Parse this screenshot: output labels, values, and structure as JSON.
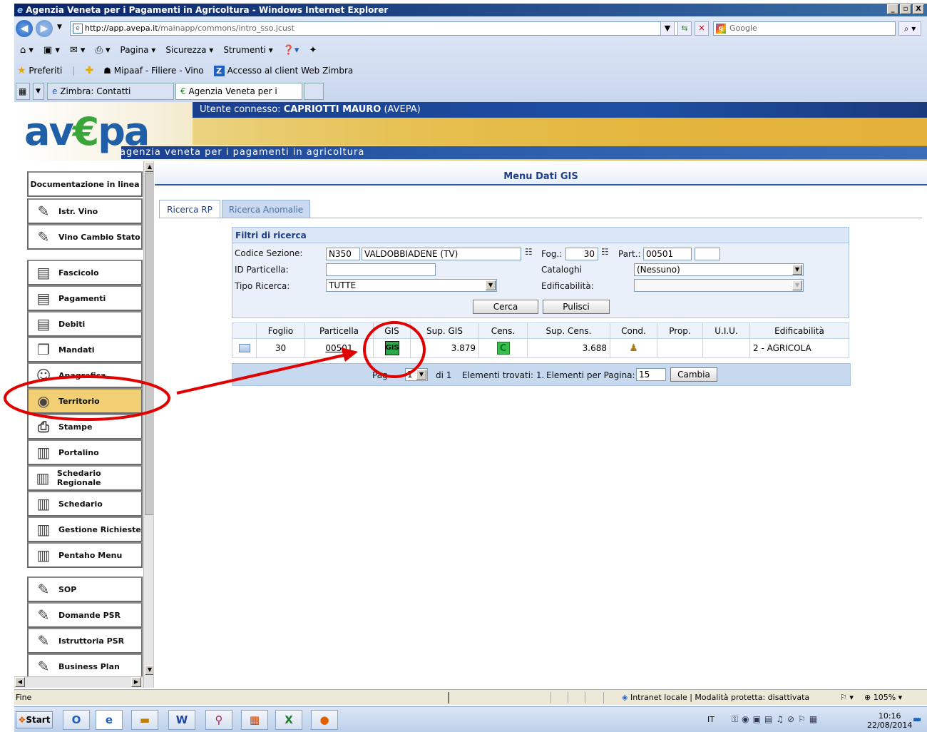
{
  "window": {
    "title": "Agenzia Veneta per i Pagamenti in Agricoltura - Windows Internet Explorer",
    "min": "_",
    "max": "▫",
    "close": "X"
  },
  "browser": {
    "url_host": "http://app.avepa.it",
    "url_path": "/mainapp/commons/intro_sso.jcust",
    "search_placeholder": "Google",
    "commands": [
      "Pagina ▾",
      "Sicurezza ▾",
      "Strumenti ▾"
    ],
    "favorites_label": "Preferiti",
    "favorites": [
      "Mipaaf - Filiere - Vino",
      "Accesso al client Web Zimbra"
    ],
    "tabs": [
      "Zimbra: Contatti",
      "Agenzia Veneta per i Pag..."
    ]
  },
  "header": {
    "user_prefix": "Utente connesso:",
    "user_name": "CAPRIOTTI MAURO",
    "user_org": "(AVEPA)",
    "logo_a": "av",
    "logo_e": "€",
    "logo_b": "pa",
    "tagline": "agenzia veneta per i pagamenti in agricoltura"
  },
  "sidebar": {
    "items": [
      "Documentazione in linea",
      "Istr. Vino",
      "Vino Cambio Stato",
      "Fascicolo",
      "Pagamenti",
      "Debiti",
      "Mandati",
      "Anagrafica",
      "Territorio",
      "Stampe",
      "Portalino",
      "Schedario Regionale",
      "Schedario",
      "Gestione Richieste",
      "Pentaho Menu",
      "SOP",
      "Domande PSR",
      "Istruttoria PSR",
      "Business Plan"
    ],
    "active": "Territorio"
  },
  "main": {
    "title": "Menu Dati GIS",
    "tabs": [
      "Ricerca RP",
      "Ricerca Anomalie"
    ],
    "filters": {
      "heading": "Filtri di ricerca",
      "codice_label": "Codice Sezione:",
      "codice_code": "N350",
      "codice_name": "VALDOBBIADENE (TV)",
      "fog_label": "Fog.:",
      "fog_value": "30",
      "part_label": "Part.:",
      "part_value": "00501",
      "part_extra": "",
      "id_label": "ID Particella:",
      "id_value": "",
      "cataloghi_label": "Cataloghi",
      "cataloghi_value": "(Nessuno)",
      "tipo_label": "Tipo Ricerca:",
      "tipo_value": "TUTTE",
      "edif_label": "Edificabilità:",
      "edif_value": "",
      "search_btn": "Cerca",
      "clear_btn": "Pulisci"
    },
    "results": {
      "columns": [
        "",
        "Foglio",
        "Particella",
        "GIS",
        "Sup. GIS",
        "Cens.",
        "Sup. Cens.",
        "Cond.",
        "Prop.",
        "U.I.U.",
        "Edificabilità"
      ],
      "row": {
        "foglio": "30",
        "particella": "00501",
        "gis": "GIS",
        "sup_gis": "3.879",
        "cens": "C",
        "sup_cens": "3.688",
        "prop": "",
        "uiu": "",
        "edif": "2 - AGRICOLA"
      }
    },
    "pager": {
      "page_label": "Pag",
      "page_value": "1",
      "of": "di 1",
      "found": "Elementi trovati: 1.",
      "per_page_label": "Elementi per Pagina:",
      "per_page_value": "15",
      "change_btn": "Cambia"
    }
  },
  "status": {
    "left": "Fine",
    "zone": "Intranet locale | Modalità protetta: disattivata",
    "zoom": "105%"
  },
  "taskbar": {
    "start": "Start",
    "lang": "IT",
    "time": "10:16",
    "date": "22/08/2014"
  },
  "colors": {
    "annotation": "#e00000",
    "active_menu": "#f3cf73",
    "brand_blue": "#1f4fa3"
  }
}
